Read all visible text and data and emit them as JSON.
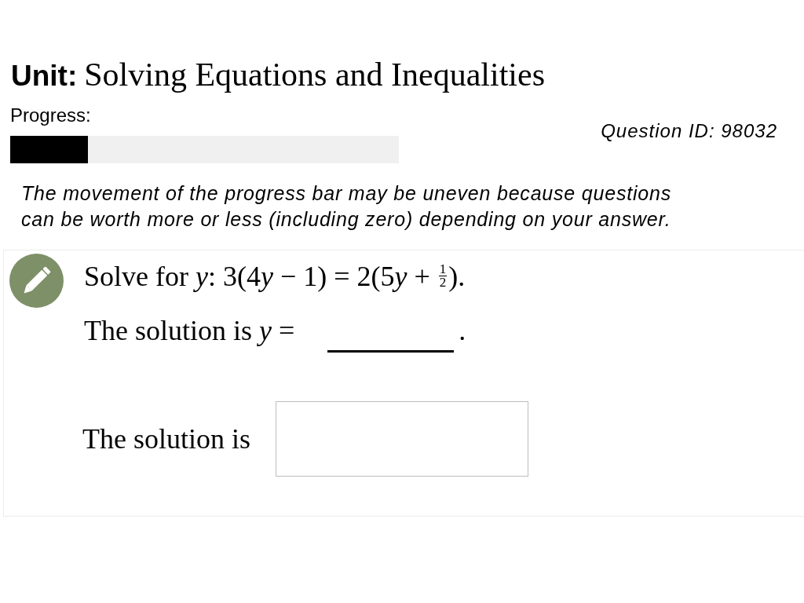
{
  "unit": {
    "label": "Unit:",
    "title": "Solving Equations and Inequalities"
  },
  "progress": {
    "label": "Progress:",
    "level": 0.2
  },
  "question_id": "Question ID: 98032",
  "note": "The movement of the progress bar may be uneven because questions can be worth more or less (including zero) depending on your answer.",
  "question": {
    "statement": [
      {
        "kind": "text",
        "text": "Solve for "
      },
      {
        "kind": "variable",
        "text": "y"
      },
      {
        "kind": "text",
        "text": ": 3(4"
      },
      {
        "kind": "variable",
        "text": "y"
      },
      {
        "kind": "text",
        "text": " − 1) = 2(5"
      },
      {
        "kind": "variable",
        "text": "y"
      },
      {
        "kind": "text",
        "text": " + "
      },
      {
        "kind": "fraction",
        "numerator": "1",
        "denominator": "2"
      },
      {
        "kind": "text",
        "text": ")."
      }
    ],
    "answer_line": {
      "prompt": [
        {
          "kind": "text",
          "text": "The solution is "
        },
        {
          "kind": "variable",
          "text": "y"
        },
        {
          "kind": "text",
          "text": " ="
        }
      ],
      "end": "."
    },
    "answer_box": {
      "label": "The solution is"
    }
  }
}
